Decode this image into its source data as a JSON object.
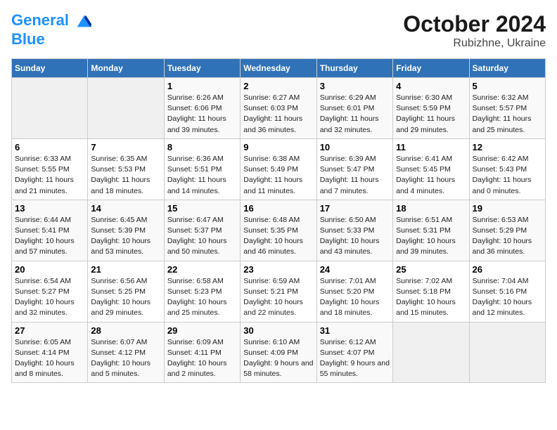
{
  "logo": {
    "line1": "General",
    "line2": "Blue"
  },
  "title": "October 2024",
  "subtitle": "Rubizhne, Ukraine",
  "headers": [
    "Sunday",
    "Monday",
    "Tuesday",
    "Wednesday",
    "Thursday",
    "Friday",
    "Saturday"
  ],
  "weeks": [
    [
      {
        "day": "",
        "info": ""
      },
      {
        "day": "",
        "info": ""
      },
      {
        "day": "1",
        "info": "Sunrise: 6:26 AM\nSunset: 6:06 PM\nDaylight: 11 hours and 39 minutes."
      },
      {
        "day": "2",
        "info": "Sunrise: 6:27 AM\nSunset: 6:03 PM\nDaylight: 11 hours and 36 minutes."
      },
      {
        "day": "3",
        "info": "Sunrise: 6:29 AM\nSunset: 6:01 PM\nDaylight: 11 hours and 32 minutes."
      },
      {
        "day": "4",
        "info": "Sunrise: 6:30 AM\nSunset: 5:59 PM\nDaylight: 11 hours and 29 minutes."
      },
      {
        "day": "5",
        "info": "Sunrise: 6:32 AM\nSunset: 5:57 PM\nDaylight: 11 hours and 25 minutes."
      }
    ],
    [
      {
        "day": "6",
        "info": "Sunrise: 6:33 AM\nSunset: 5:55 PM\nDaylight: 11 hours and 21 minutes."
      },
      {
        "day": "7",
        "info": "Sunrise: 6:35 AM\nSunset: 5:53 PM\nDaylight: 11 hours and 18 minutes."
      },
      {
        "day": "8",
        "info": "Sunrise: 6:36 AM\nSunset: 5:51 PM\nDaylight: 11 hours and 14 minutes."
      },
      {
        "day": "9",
        "info": "Sunrise: 6:38 AM\nSunset: 5:49 PM\nDaylight: 11 hours and 11 minutes."
      },
      {
        "day": "10",
        "info": "Sunrise: 6:39 AM\nSunset: 5:47 PM\nDaylight: 11 hours and 7 minutes."
      },
      {
        "day": "11",
        "info": "Sunrise: 6:41 AM\nSunset: 5:45 PM\nDaylight: 11 hours and 4 minutes."
      },
      {
        "day": "12",
        "info": "Sunrise: 6:42 AM\nSunset: 5:43 PM\nDaylight: 11 hours and 0 minutes."
      }
    ],
    [
      {
        "day": "13",
        "info": "Sunrise: 6:44 AM\nSunset: 5:41 PM\nDaylight: 10 hours and 57 minutes."
      },
      {
        "day": "14",
        "info": "Sunrise: 6:45 AM\nSunset: 5:39 PM\nDaylight: 10 hours and 53 minutes."
      },
      {
        "day": "15",
        "info": "Sunrise: 6:47 AM\nSunset: 5:37 PM\nDaylight: 10 hours and 50 minutes."
      },
      {
        "day": "16",
        "info": "Sunrise: 6:48 AM\nSunset: 5:35 PM\nDaylight: 10 hours and 46 minutes."
      },
      {
        "day": "17",
        "info": "Sunrise: 6:50 AM\nSunset: 5:33 PM\nDaylight: 10 hours and 43 minutes."
      },
      {
        "day": "18",
        "info": "Sunrise: 6:51 AM\nSunset: 5:31 PM\nDaylight: 10 hours and 39 minutes."
      },
      {
        "day": "19",
        "info": "Sunrise: 6:53 AM\nSunset: 5:29 PM\nDaylight: 10 hours and 36 minutes."
      }
    ],
    [
      {
        "day": "20",
        "info": "Sunrise: 6:54 AM\nSunset: 5:27 PM\nDaylight: 10 hours and 32 minutes."
      },
      {
        "day": "21",
        "info": "Sunrise: 6:56 AM\nSunset: 5:25 PM\nDaylight: 10 hours and 29 minutes."
      },
      {
        "day": "22",
        "info": "Sunrise: 6:58 AM\nSunset: 5:23 PM\nDaylight: 10 hours and 25 minutes."
      },
      {
        "day": "23",
        "info": "Sunrise: 6:59 AM\nSunset: 5:21 PM\nDaylight: 10 hours and 22 minutes."
      },
      {
        "day": "24",
        "info": "Sunrise: 7:01 AM\nSunset: 5:20 PM\nDaylight: 10 hours and 18 minutes."
      },
      {
        "day": "25",
        "info": "Sunrise: 7:02 AM\nSunset: 5:18 PM\nDaylight: 10 hours and 15 minutes."
      },
      {
        "day": "26",
        "info": "Sunrise: 7:04 AM\nSunset: 5:16 PM\nDaylight: 10 hours and 12 minutes."
      }
    ],
    [
      {
        "day": "27",
        "info": "Sunrise: 6:05 AM\nSunset: 4:14 PM\nDaylight: 10 hours and 8 minutes."
      },
      {
        "day": "28",
        "info": "Sunrise: 6:07 AM\nSunset: 4:12 PM\nDaylight: 10 hours and 5 minutes."
      },
      {
        "day": "29",
        "info": "Sunrise: 6:09 AM\nSunset: 4:11 PM\nDaylight: 10 hours and 2 minutes."
      },
      {
        "day": "30",
        "info": "Sunrise: 6:10 AM\nSunset: 4:09 PM\nDaylight: 9 hours and 58 minutes."
      },
      {
        "day": "31",
        "info": "Sunrise: 6:12 AM\nSunset: 4:07 PM\nDaylight: 9 hours and 55 minutes."
      },
      {
        "day": "",
        "info": ""
      },
      {
        "day": "",
        "info": ""
      }
    ]
  ]
}
